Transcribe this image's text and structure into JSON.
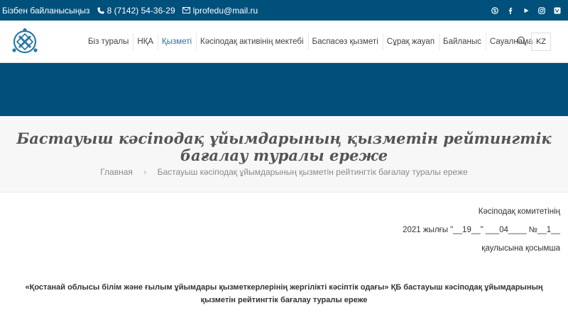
{
  "topbar": {
    "contact_label": "Бізбен байланысыңыз",
    "phone": "8 (7142) 54-36-29",
    "email": "lprofedu@mail.ru",
    "social": [
      "skype-icon",
      "facebook-icon",
      "youtube-icon",
      "instagram-icon",
      "vk-icon"
    ]
  },
  "nav": {
    "items": [
      {
        "label": "Біз туралы"
      },
      {
        "label": "НҚА"
      },
      {
        "label": "Қызметі"
      },
      {
        "label": "Кәсіподақ активінің мектебі"
      },
      {
        "label": "Баспасөз қызметі"
      },
      {
        "label": "Сұрақ жауап"
      },
      {
        "label": "Байланыс"
      },
      {
        "label": "Сауалнама"
      }
    ],
    "active_index": 2,
    "lang": "KZ"
  },
  "page": {
    "title": "Бастауыш кәсіподақ ұйымдарының қызметін рейтингтік бағалау туралы ереже",
    "breadcrumb_home": "Главная",
    "breadcrumb_current": "Бастауыш кәсіподақ ұйымдарының қызметін рейтингтік бағалау туралы ереже"
  },
  "content": {
    "line1": "Кәсіподақ комитетінің",
    "line2": "2021 жылғы \"__19__\" ___04____ №__1__",
    "line3": "қаулысына қосымша",
    "heading": "«Қостанай облысы білім және ғылым ұйымдары қызметкерлерінің жергілікті кәсіптік одағы» ҚБ бастауыш кәсіподақ ұйымдарының қызметін рейтингтік бағалау туралы ереже"
  },
  "colors": {
    "brand": "#00507c",
    "active_nav": "#2a6fa3"
  }
}
